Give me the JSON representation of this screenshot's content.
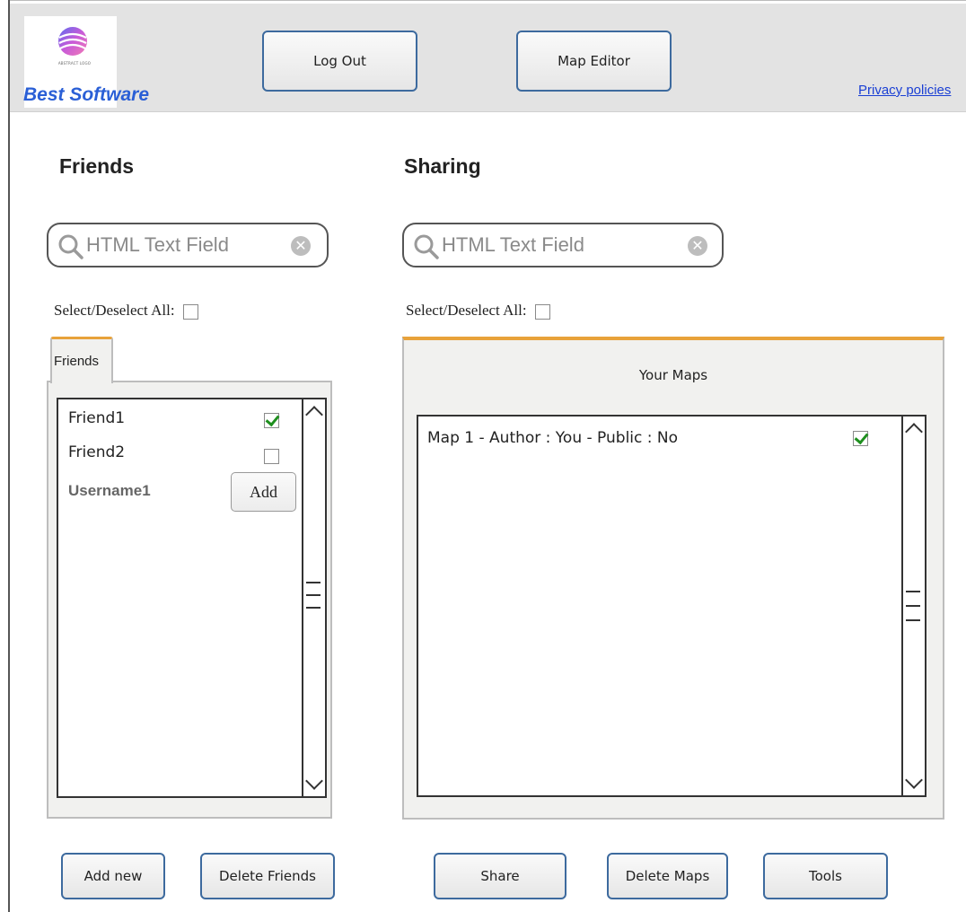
{
  "header": {
    "logo_small_text": "ABSTRACT LOGO",
    "logo_text": "Best Software",
    "logout_label": "Log Out",
    "map_editor_label": "Map Editor",
    "privacy_label": "Privacy policies"
  },
  "friends": {
    "title": "Friends",
    "search_placeholder": "HTML Text Field",
    "select_all_label": "Select/Deselect All:",
    "tab_label": "Friends",
    "items": [
      {
        "name": "Friend1",
        "checked": true
      },
      {
        "name": "Friend2",
        "checked": false
      }
    ],
    "pending": {
      "username": "Username1",
      "add_label": "Add"
    },
    "add_new_label": "Add new",
    "delete_label": "Delete Friends"
  },
  "sharing": {
    "title": "Sharing",
    "search_placeholder": "HTML Text Field",
    "select_all_label": "Select/Deselect All:",
    "panel_title": "Your Maps",
    "maps": [
      {
        "label": "Map 1 - Author : You - Public : No",
        "checked": true
      }
    ],
    "share_label": "Share",
    "delete_label": "Delete Maps",
    "tools_label": "Tools"
  },
  "colors": {
    "accent_tab": "#e8a23a",
    "button_border": "#3d6a9e",
    "link": "#1a3fd4",
    "logo_text": "#2a5fd6",
    "check": "#1e8f1e"
  }
}
